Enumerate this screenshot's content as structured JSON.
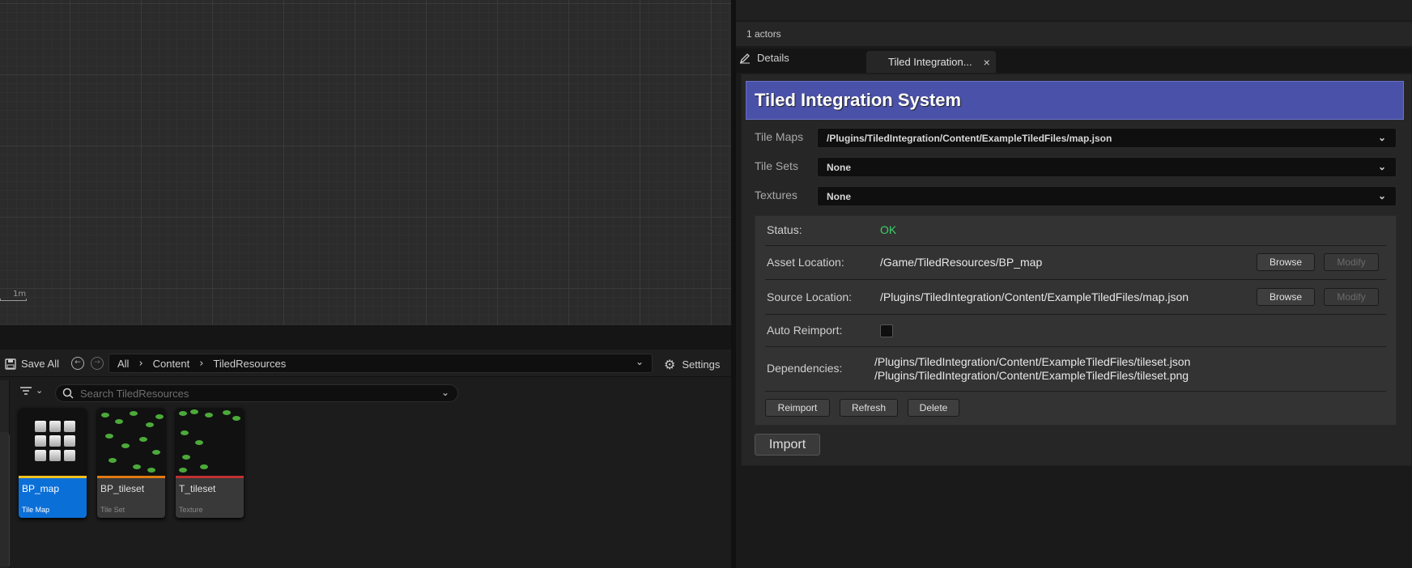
{
  "viewport": {
    "scale_label": "1m"
  },
  "content_browser": {
    "save_all_label": "Save All",
    "breadcrumb": [
      "All",
      "Content",
      "TiledResources"
    ],
    "settings_label": "Settings",
    "search_placeholder": "Search TiledResources",
    "assets": [
      {
        "name": "BP_map",
        "type": "Tile Map",
        "bar_color": "#f0c020",
        "selected": true
      },
      {
        "name": "BP_tileset",
        "type": "Tile Set",
        "bar_color": "#e07a10",
        "selected": false
      },
      {
        "name": "T_tileset",
        "type": "Texture",
        "bar_color": "#c03030",
        "selected": false
      }
    ]
  },
  "right_panel": {
    "actors_label": "1 actors",
    "tabs": {
      "details": "Details",
      "tiled": "Tiled Integration...",
      "tiled_close": "×"
    },
    "header_title": "Tiled Integration System",
    "properties": [
      {
        "label": "Tile Maps",
        "value": "/Plugins/TiledIntegration/Content/ExampleTiledFiles/map.json"
      },
      {
        "label": "Tile Sets",
        "value": "None"
      },
      {
        "label": "Textures",
        "value": "None"
      }
    ],
    "info": {
      "status_label": "Status:",
      "status_value": "OK",
      "status_color": "#3ad16a",
      "asset_location_label": "Asset Location:",
      "asset_location_value": "/Game/TiledResources/BP_map",
      "source_location_label": "Source Location:",
      "source_location_value": "/Plugins/TiledIntegration/Content/ExampleTiledFiles/map.json",
      "browse_label": "Browse",
      "modify_label": "Modify",
      "auto_reimport_label": "Auto Reimport:",
      "dependencies_label": "Dependencies:",
      "dependencies": [
        "/Plugins/TiledIntegration/Content/ExampleTiledFiles/tileset.json",
        "/Plugins/TiledIntegration/Content/ExampleTiledFiles/tileset.png"
      ],
      "reimport_label": "Reimport",
      "refresh_label": "Refresh",
      "delete_label": "Delete"
    },
    "import_label": "Import"
  }
}
